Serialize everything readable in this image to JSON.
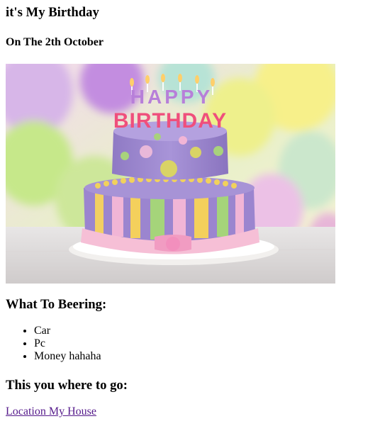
{
  "header": {
    "title": "it's My Birthday",
    "subtitle": "On The 2th October"
  },
  "image": {
    "cake_text": "HAPPY BIRTHDAY"
  },
  "bring": {
    "heading": "What To Beering:",
    "items": [
      "Car",
      "Pc",
      "Money hahaha"
    ]
  },
  "go": {
    "heading": "This you where to go:",
    "link_label": "Location My House"
  },
  "colors": {
    "link_visited": "#551a8b",
    "text": "#000000",
    "background": "#ffffff"
  }
}
